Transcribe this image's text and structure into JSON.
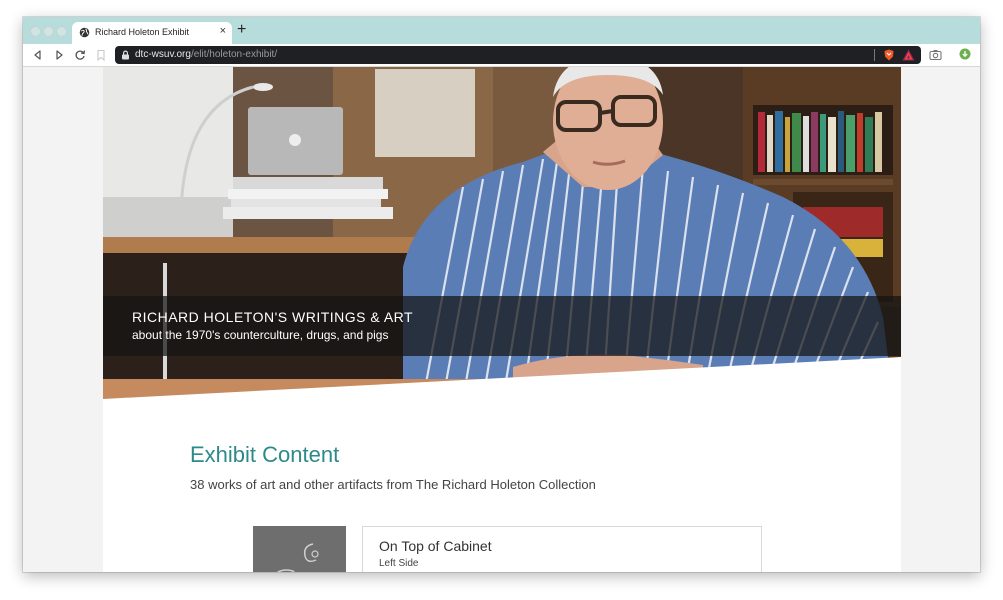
{
  "browser": {
    "tab_title": "Richard Holeton Exhibit",
    "tab_close": "×",
    "new_tab": "+",
    "url_domain": "dtc-wsuv.org",
    "url_path": "/elit/holeton-exhibit/",
    "icons": {
      "back": "back-arrow-icon",
      "forward": "forward-arrow-icon",
      "reload": "reload-icon",
      "bookmark": "bookmark-icon",
      "lock": "lock-icon",
      "shields": "brave-shields-icon",
      "rewards": "brave-rewards-icon",
      "screenshot": "camera-icon",
      "extension": "extension-icon"
    },
    "colors": {
      "tabstrip": "#b6dcdb",
      "urlbar": "#1e2024"
    }
  },
  "hero": {
    "title": "RICHARD HOLETON'S WRITINGS & ART",
    "subtitle": "about the 1970's counterculture, drugs, and pigs"
  },
  "exhibit": {
    "title": "Exhibit Content",
    "subtitle": "38 works of art and other artifacts from The Richard Holeton Collection",
    "accent_color": "#2e8a8a",
    "items": [
      {
        "title": "On Top of Cabinet",
        "subtitle": "Left Side"
      }
    ]
  }
}
